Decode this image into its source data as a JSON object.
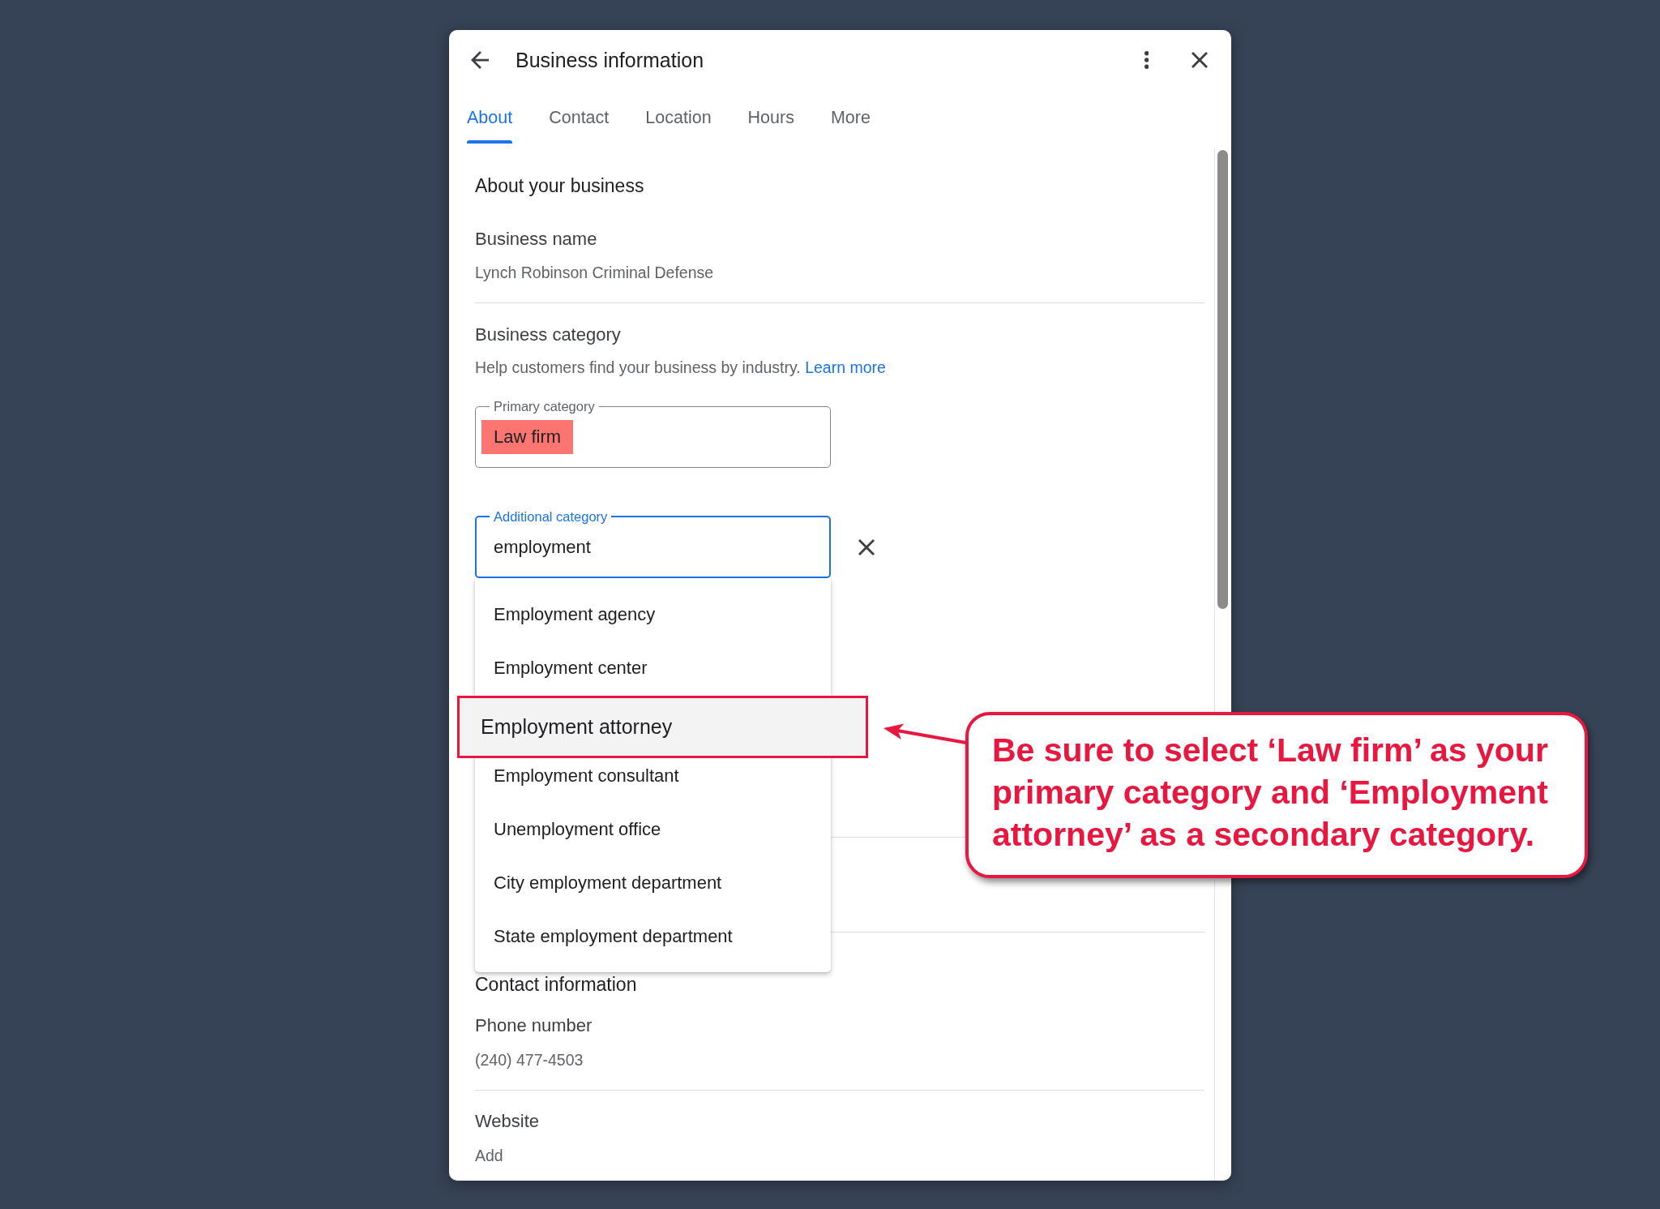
{
  "dialog": {
    "title": "Business information"
  },
  "tabs": [
    {
      "label": "About",
      "selected": true
    },
    {
      "label": "Contact",
      "selected": false
    },
    {
      "label": "Location",
      "selected": false
    },
    {
      "label": "Hours",
      "selected": false
    },
    {
      "label": "More",
      "selected": false
    }
  ],
  "about": {
    "heading": "About your business",
    "business_name": {
      "label": "Business name",
      "value": "Lynch Robinson Criminal Defense"
    }
  },
  "business_category": {
    "label": "Business category",
    "help_text": "Help customers find your business by industry.",
    "link": "Learn more",
    "primary_category": {
      "label": "Primary category",
      "value": "Law firm",
      "highlighted": true
    },
    "additional_category": {
      "label": "Additional category",
      "value": "employment",
      "focused": true
    },
    "suggestions": [
      {
        "label": "Employment agency",
        "selected": false
      },
      {
        "label": "Employment center",
        "selected": false
      },
      {
        "label": "Employment attorney",
        "selected": true
      },
      {
        "label": "Employment consultant",
        "selected": false
      },
      {
        "label": "Unemployment office",
        "selected": false
      },
      {
        "label": "City employment department",
        "selected": false
      },
      {
        "label": "State employment department",
        "selected": false
      }
    ]
  },
  "contact": {
    "heading": "Contact information",
    "fields": [
      {
        "label": "Phone number",
        "value": "(240) 477-4503"
      },
      {
        "label": "Website",
        "value": "Add"
      }
    ]
  },
  "annotation": {
    "text": "Be sure to select ‘Law firm’ as your primary category and ‘Employment attorney’ as a secondary category."
  }
}
